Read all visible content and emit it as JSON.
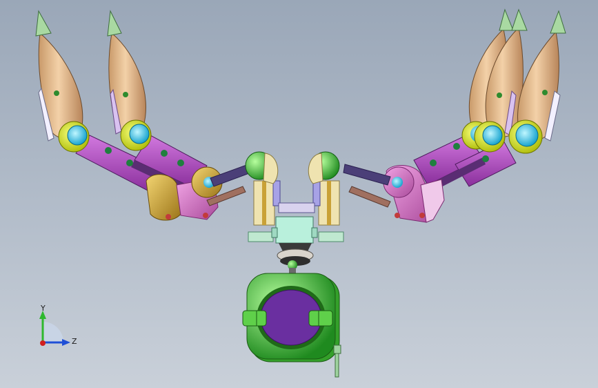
{
  "triad": {
    "y_label": "Y",
    "z_label": "Z"
  },
  "colors": {
    "background_top": "#9aa7b8",
    "background_bottom": "#c9d0d9",
    "finger_shell": "#e2b98a",
    "finger_tip": "#9fd39f",
    "joint_ring": "#e4f02f",
    "joint_center": "#35c9ee",
    "link_purple": "#b24fc0",
    "link_dark": "#5a2d73",
    "base_green": "#5fd04a",
    "base_purple": "#6a2fa0",
    "frame_cream": "#efe3b0",
    "gear_gold": "#c9a136",
    "axis_y": "#2eb82e",
    "axis_z": "#1f4fd6",
    "axis_origin": "#d11f1f"
  }
}
